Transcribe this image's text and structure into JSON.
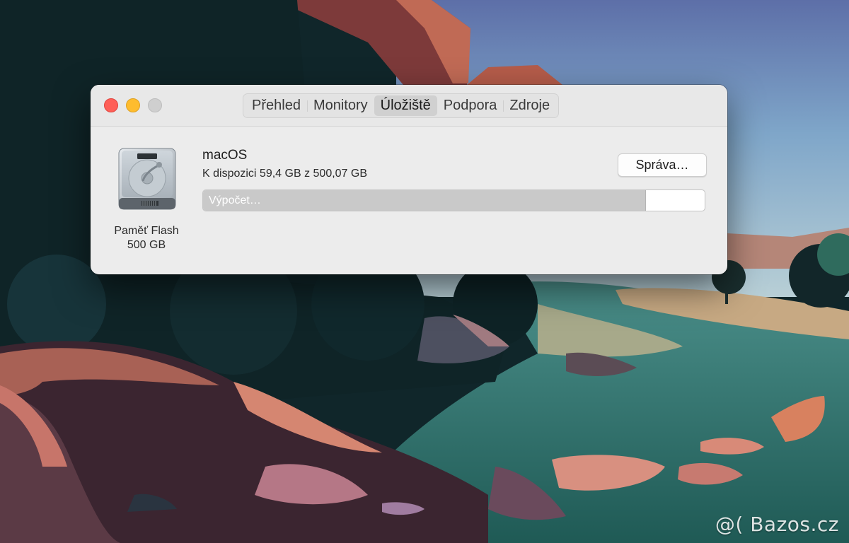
{
  "window": {
    "tabs": [
      {
        "label": "Přehled",
        "active": false
      },
      {
        "label": "Monitory",
        "active": false
      },
      {
        "label": "Úložiště",
        "active": true
      },
      {
        "label": "Podpora",
        "active": false
      },
      {
        "label": "Zdroje",
        "active": false
      }
    ]
  },
  "storage": {
    "disk_name": "Paměť Flash",
    "disk_size": "500 GB",
    "volume_name": "macOS",
    "availability": "K dispozici 59,4 GB z 500,07 GB",
    "manage_label": "Správa…",
    "calculating_label": "Výpočet…",
    "used_fraction": 0.881
  },
  "watermark": "@( Bazos.cz"
}
